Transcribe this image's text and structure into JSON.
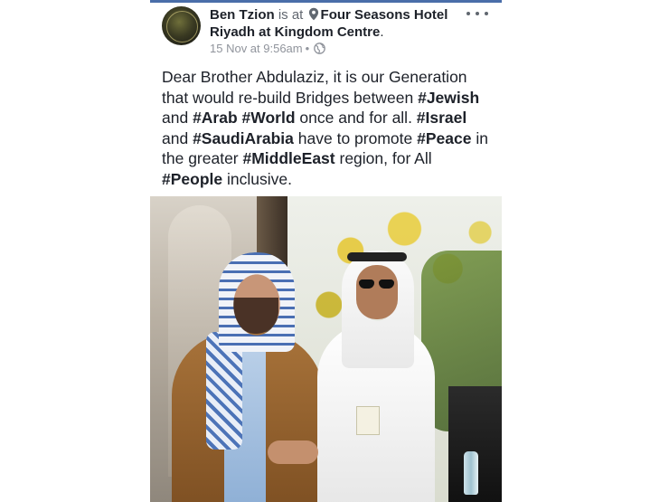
{
  "post": {
    "author": "Ben Tzion",
    "is_at": "is at",
    "place_line1": "Four Seasons Hotel",
    "place_line2": "Riyadh at Kingdom Centre",
    "place_period": ".",
    "timestamp": "15 Nov at 9:56am",
    "separator": "•",
    "privacy_icon": "globe-icon",
    "location_icon": "pin-icon",
    "menu_icon": "more-options-icon",
    "text_segments": [
      {
        "text": "Dear Brother Abdulaziz, it is our Generation that would re-build Bridges between ",
        "bold": false
      },
      {
        "text": "#Jewish",
        "bold": true
      },
      {
        "text": " and ",
        "bold": false
      },
      {
        "text": "#Arab",
        "bold": true
      },
      {
        "text": " ",
        "bold": false
      },
      {
        "text": "#World",
        "bold": true
      },
      {
        "text": " once and for all. ",
        "bold": false
      },
      {
        "text": "#Israel",
        "bold": true
      },
      {
        "text": " and ",
        "bold": false
      },
      {
        "text": "#SaudiArabia",
        "bold": true
      },
      {
        "text": " have to promote ",
        "bold": false
      },
      {
        "text": "#Peace",
        "bold": true
      },
      {
        "text": " in the greater ",
        "bold": false
      },
      {
        "text": "#MiddleEast",
        "bold": true
      },
      {
        "text": " region, for All ",
        "bold": false
      },
      {
        "text": "#People",
        "bold": true
      },
      {
        "text": " inclusive.",
        "bold": false
      }
    ]
  },
  "colors": {
    "top_accent": "#4a6ea9",
    "text_primary": "#1d2129",
    "text_secondary": "#90949c"
  }
}
